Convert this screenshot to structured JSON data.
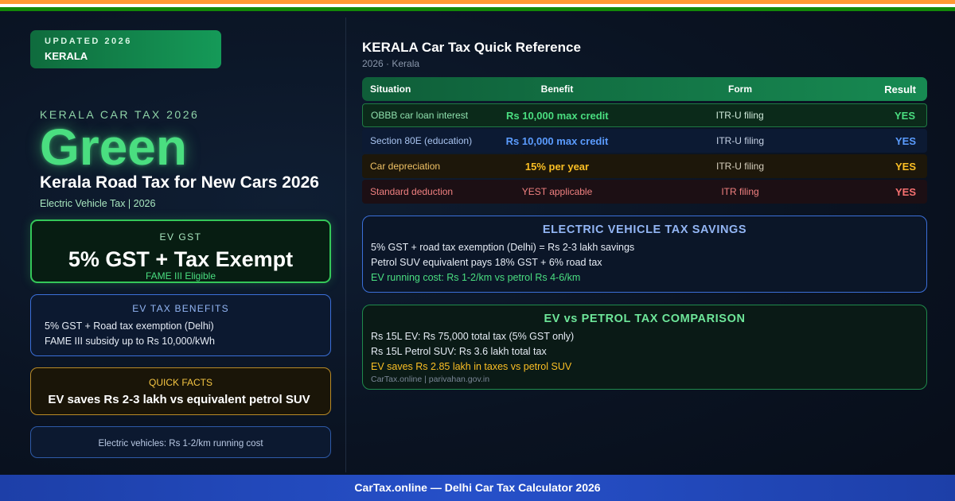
{
  "colors": {
    "saffron": "#ff9933",
    "white": "#ffffff",
    "india_green": "#138808",
    "accent_green": "#4ade80",
    "accent_blue": "#5b9cff",
    "accent_yellow": "#fbbf24",
    "accent_red": "#f87171",
    "footer_blue": "#2650c9"
  },
  "badge": {
    "line1": "UPDATED 2026",
    "line2": "KERALA"
  },
  "hero": {
    "eyebrow": "KERALA CAR TAX 2026",
    "word": "Green",
    "title": "Kerala Road Tax for New Cars 2026",
    "subtitle": "Electric Vehicle Tax | 2026"
  },
  "cards": {
    "gst": {
      "label": "EV GST",
      "value": "5% GST + Tax Exempt",
      "note": "FAME III Eligible"
    },
    "benefits": {
      "label": "EV TAX BENEFITS",
      "lines": [
        "5% GST + Road tax exemption (Delhi)",
        "FAME III subsidy up to Rs 10,000/kWh"
      ]
    },
    "quick_facts": {
      "label": "QUICK FACTS",
      "value": "EV saves Rs 2-3 lakh vs equivalent petrol SUV"
    },
    "running_cost": {
      "text": "Electric vehicles: Rs 1-2/km running cost"
    }
  },
  "reference": {
    "title": "KERALA Car Tax Quick Reference",
    "subtitle": "2026 · Kerala",
    "columns": [
      "Situation",
      "Benefit",
      "Form",
      "Result"
    ],
    "rows": [
      {
        "situation": "OBBB car loan interest",
        "benefit": "Rs 10,000 max credit",
        "form": "ITR-U filing",
        "result": "YES"
      },
      {
        "situation": "Section 80E (education)",
        "benefit": "Rs 10,000 max credit",
        "form": "ITR-U filing",
        "result": "YES"
      },
      {
        "situation": "Car depreciation",
        "benefit": "15% per year",
        "form": "ITR-U filing",
        "result": "YES"
      },
      {
        "situation": "Standard deduction",
        "benefit": "YEST applicable",
        "form": "ITR filing",
        "result": "YES"
      }
    ]
  },
  "ev_savings": {
    "heading": "ELECTRIC VEHICLE TAX SAVINGS",
    "lines": [
      "5% GST + road tax exemption (Delhi) = Rs 2-3 lakh savings",
      "Petrol SUV equivalent pays 18% GST + 6% road tax",
      "EV running cost: Rs 1-2/km vs petrol Rs 4-6/km"
    ]
  },
  "comparison": {
    "heading": "EV vs PETROL TAX COMPARISON",
    "lines": [
      "Rs 15L EV: Rs 75,000 total tax (5% GST only)",
      "Rs 15L Petrol SUV: Rs 3.6 lakh total tax",
      "EV saves Rs 2.85 lakh in taxes vs petrol SUV"
    ],
    "source": "CarTax.online | parivahan.gov.in"
  },
  "footer": {
    "text": "CarTax.online — Delhi Car Tax Calculator 2026"
  }
}
